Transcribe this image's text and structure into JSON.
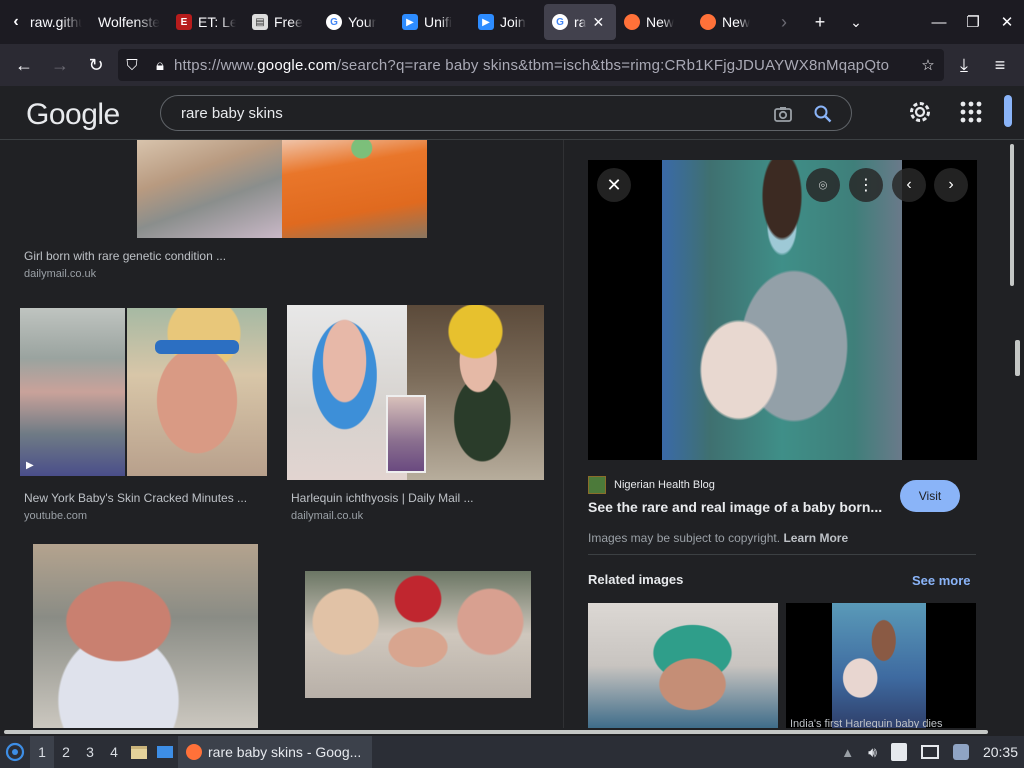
{
  "browser": {
    "tabs": [
      {
        "title": "raw.githubusercontent.com",
        "favicon": "back-arrow-icon",
        "active": false
      },
      {
        "title": "Wolfenstein",
        "favicon": "none",
        "active": false
      },
      {
        "title": "ET: Legacy",
        "favicon": "etl-icon",
        "active": false
      },
      {
        "title": "Free",
        "favicon": "page-icon",
        "active": false
      },
      {
        "title": "Your",
        "favicon": "google-icon",
        "active": false
      },
      {
        "title": "Unifi",
        "favicon": "zoom-icon",
        "active": false
      },
      {
        "title": "Join",
        "favicon": "zoom-icon",
        "active": false
      },
      {
        "title": "ra",
        "favicon": "google-icon",
        "active": true
      },
      {
        "title": "New",
        "favicon": "firefox-icon",
        "active": false
      },
      {
        "title": "New",
        "favicon": "firefox-icon",
        "active": false
      }
    ],
    "url_prefix": "https://www.",
    "url_domain": "google.com",
    "url_path": "/search?q=rare baby skins&tbm=isch&tbs=rimg:CRb1KFjgJDUAYWX8nMqapQto"
  },
  "google": {
    "logo": "Google",
    "query": "rare baby skins"
  },
  "results": [
    {
      "caption": "Girl born with rare genetic condition ...",
      "source": "dailymail.co.uk"
    },
    {
      "caption": "New York Baby's Skin Cracked Minutes ...",
      "source": "youtube.com"
    },
    {
      "caption": "Harlequin ichthyosis | Daily Mail ...",
      "source": "dailymail.co.uk"
    }
  ],
  "preview": {
    "site": "Nigerian Health Blog",
    "title": "See the rare and real image of a baby born...",
    "visit": "Visit",
    "copyright": "Images may be subject to copyright.",
    "learn_more": "Learn More",
    "related": "Related images",
    "see_more": "See more",
    "related_caption": "India's first Harlequin baby dies"
  },
  "taskbar": {
    "workspaces": [
      "1",
      "2",
      "3",
      "4"
    ],
    "task_title": "rare baby skins - Goog...",
    "clock": "20:35"
  },
  "colors": {
    "accent": "#8ab4f8",
    "background": "#202124"
  }
}
